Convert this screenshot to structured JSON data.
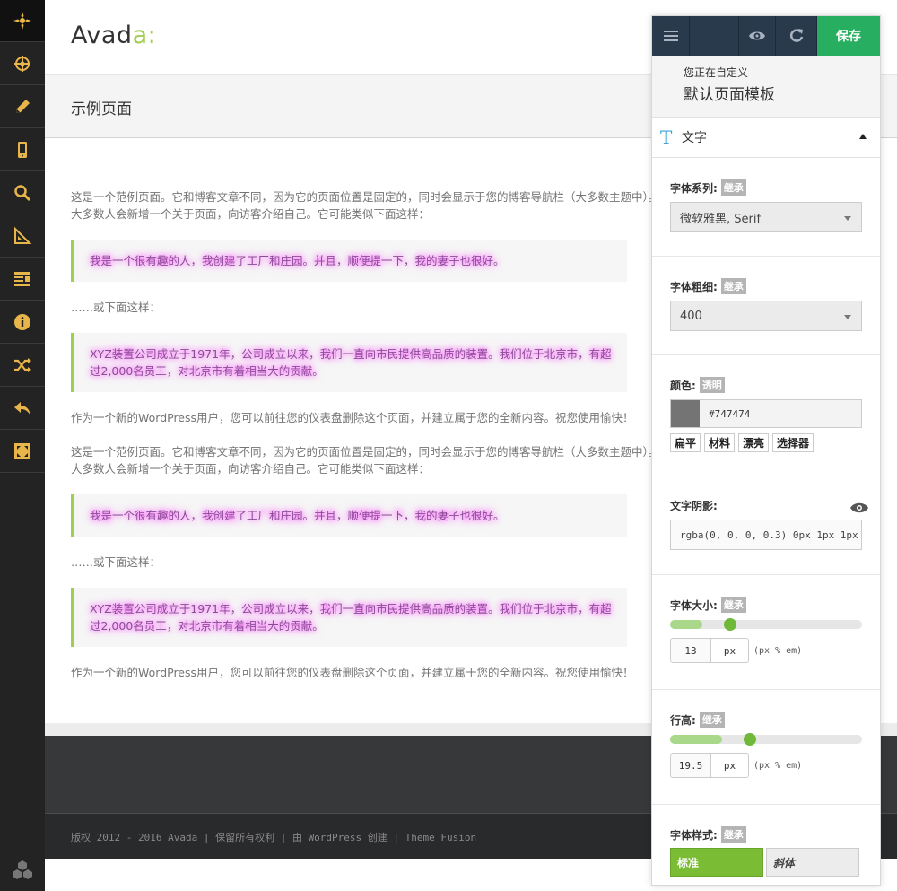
{
  "site": {
    "logo_text": "Avad",
    "logo_accent": "a",
    "logo_colon": ":",
    "page_title": "示例页面",
    "paragraphs": {
      "intro": "这是一个范例页面。它和博客文章不同，因为它的页面位置是固定的，同时会显示于您的博客导航栏（大多数主题中）。大多数人会新增一个关于页面，向访客介绍自己。它可能类似下面这样：",
      "quote1": "我是一个很有趣的人，我创建了工厂和庄园。并且，顺便提一下，我的妻子也很好。",
      "or_like": "……或下面这样：",
      "quote2": "XYZ装置公司成立于1971年，公司成立以来，我们一直向市民提供高品质的装置。我们位于北京市，有超过2,000名员工，对北京市有着相当大的贡献。",
      "closing": "作为一个新的WordPress用户，您可以前往您的仪表盘删除这个页面，并建立属于您的全新内容。祝您使用愉快！"
    },
    "copyright": "版权 2012 - 2016 Avada | 保留所有权利 | 由 WordPress 创建 | Theme Fusion"
  },
  "customizer": {
    "save_label": "保存",
    "customizing_label": "您正在自定义",
    "customizing_title": "默认页面模板",
    "section_icon_glyph": "T",
    "section_title": "文字",
    "font_family": {
      "label": "字体系列:",
      "tag": "继承",
      "value": "微软雅黑, Serif"
    },
    "font_weight": {
      "label": "字体粗细:",
      "tag": "继承",
      "value": "400"
    },
    "color": {
      "label": "颜色:",
      "tag": "透明",
      "value": "#747474",
      "swatch": "#747474",
      "palette": [
        "扁平",
        "材料",
        "漂亮",
        "选择器"
      ]
    },
    "text_shadow": {
      "label": "文字阴影:",
      "value": "rgba(0, 0, 0, 0.3) 0px 1px 1px"
    },
    "font_size": {
      "label": "字体大小:",
      "tag": "继承",
      "value": "13",
      "unit": "px",
      "units_hint": "(px % em)",
      "slider_fraction": 0.17
    },
    "line_height": {
      "label": "行高:",
      "tag": "继承",
      "value": "19.5",
      "unit": "px",
      "units_hint": "(px % em)",
      "slider_fraction": 0.27
    },
    "font_style": {
      "label": "字体样式:",
      "tag": "继承",
      "options": [
        "标准",
        "斜体"
      ]
    }
  },
  "colors": {
    "accent_green": "#a0ce4e",
    "save_green": "#27ae60",
    "panel_dark": "#2a3a4d",
    "toolbar_icon": "#f0c060"
  },
  "toolbar_icons": [
    "compass-icon",
    "target-icon",
    "pencil-icon",
    "mobile-icon",
    "search-icon",
    "ruler-icon",
    "layout-icon",
    "info-icon",
    "shuffle-icon",
    "undo-icon",
    "fullscreen-icon"
  ]
}
